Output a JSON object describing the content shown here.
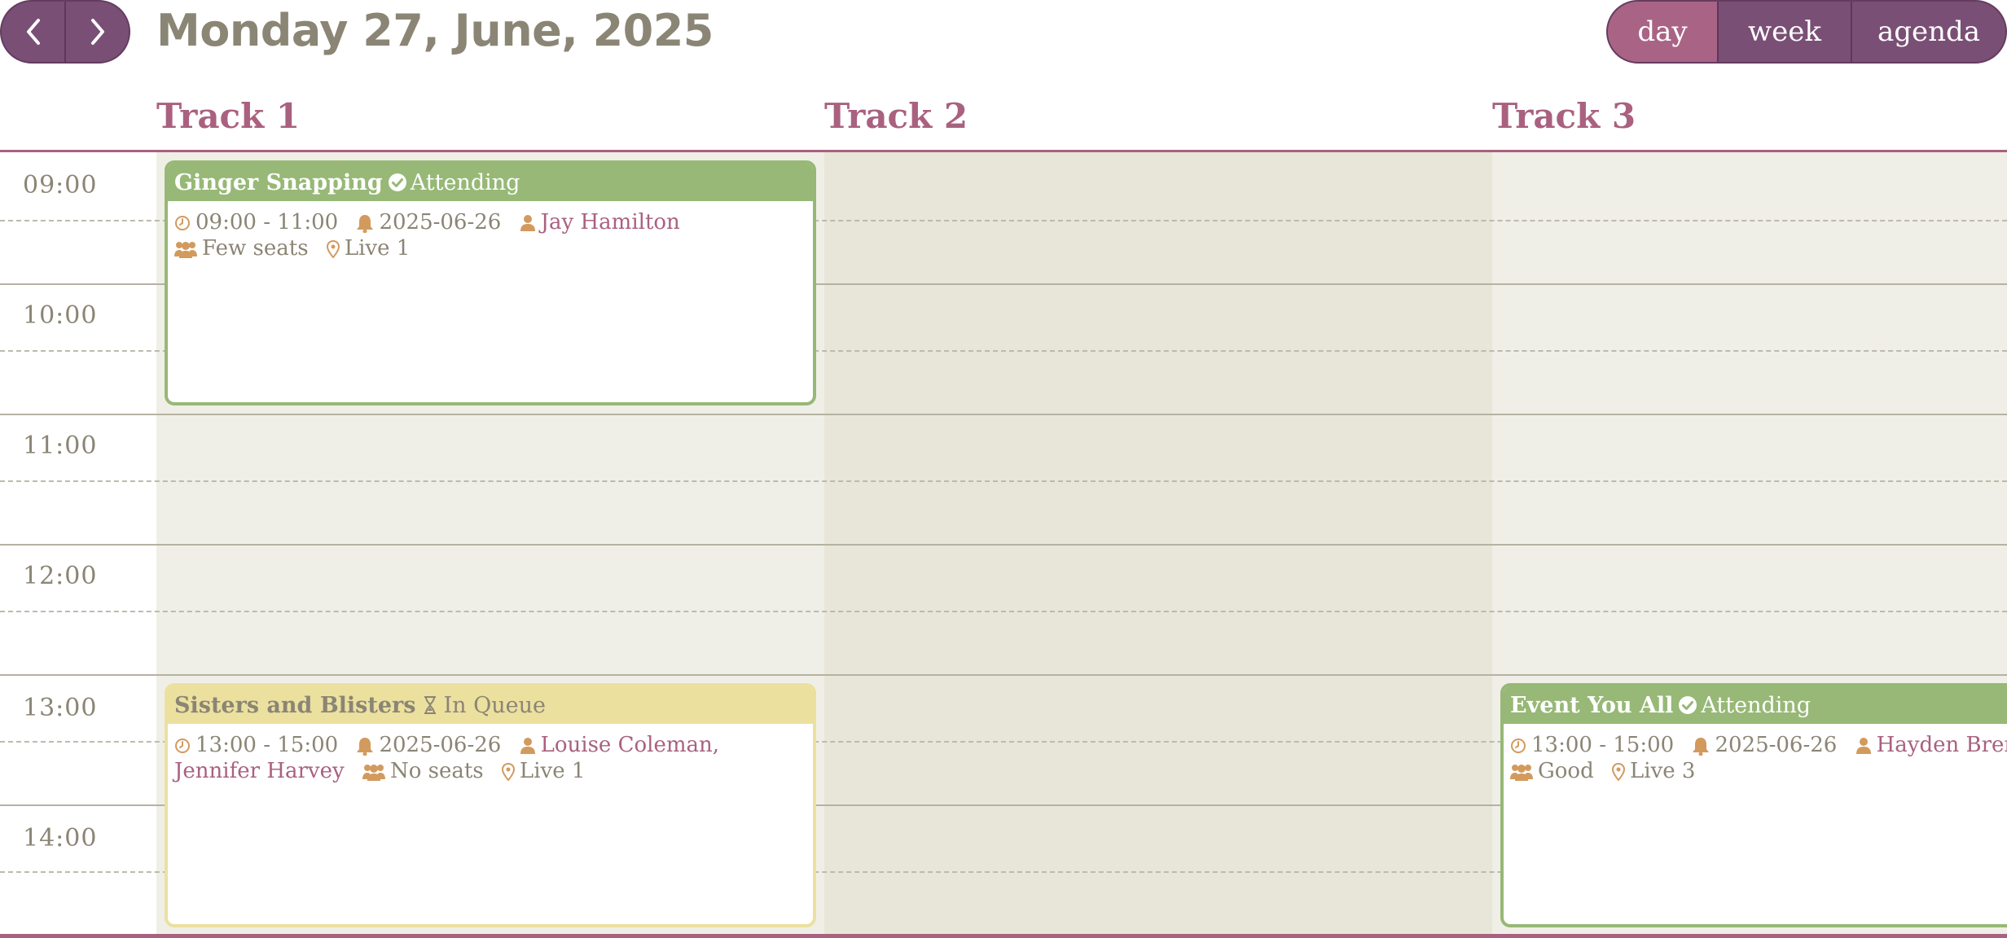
{
  "header": {
    "title": "Monday 27, June, 2025",
    "views": [
      {
        "label": "day",
        "active": true
      },
      {
        "label": "week",
        "active": false
      },
      {
        "label": "agenda",
        "active": false
      }
    ]
  },
  "tracks": [
    "Track 1",
    "Track 2",
    "Track 3"
  ],
  "times": [
    "09:00",
    "10:00",
    "11:00",
    "12:00",
    "13:00",
    "14:00"
  ],
  "events": [
    {
      "title": "Ginger Snapping",
      "status": "Attending",
      "status_icon": "check-circle-icon",
      "time": "09:00 - 11:00",
      "date": "2025-06-26",
      "people": "Jay Hamilton",
      "people_line2": "",
      "seats": "Few seats",
      "location": "Live 1"
    },
    {
      "title": "Sisters and Blisters",
      "status": "In Queue",
      "status_icon": "hourglass-icon",
      "time": "13:00 - 15:00",
      "date": "2025-06-26",
      "people": "Louise Coleman,",
      "people_line2": "Jennifer Harvey",
      "seats": "No seats",
      "location": "Live 1"
    },
    {
      "title": "Event You All",
      "status": "Attending",
      "status_icon": "check-circle-icon",
      "time": "13:00 - 15:00",
      "date": "2025-06-26",
      "people": "Hayden Bren",
      "people_line2": "",
      "seats": "Good",
      "location": "Live 3"
    }
  ],
  "colors": {
    "plum": "#7a4f75",
    "rose": "#a9617f",
    "attending_green": "#97b876",
    "queue_yellow": "#ece09f",
    "icon_orange": "#d39a5e",
    "text_gray": "#8b8575"
  }
}
